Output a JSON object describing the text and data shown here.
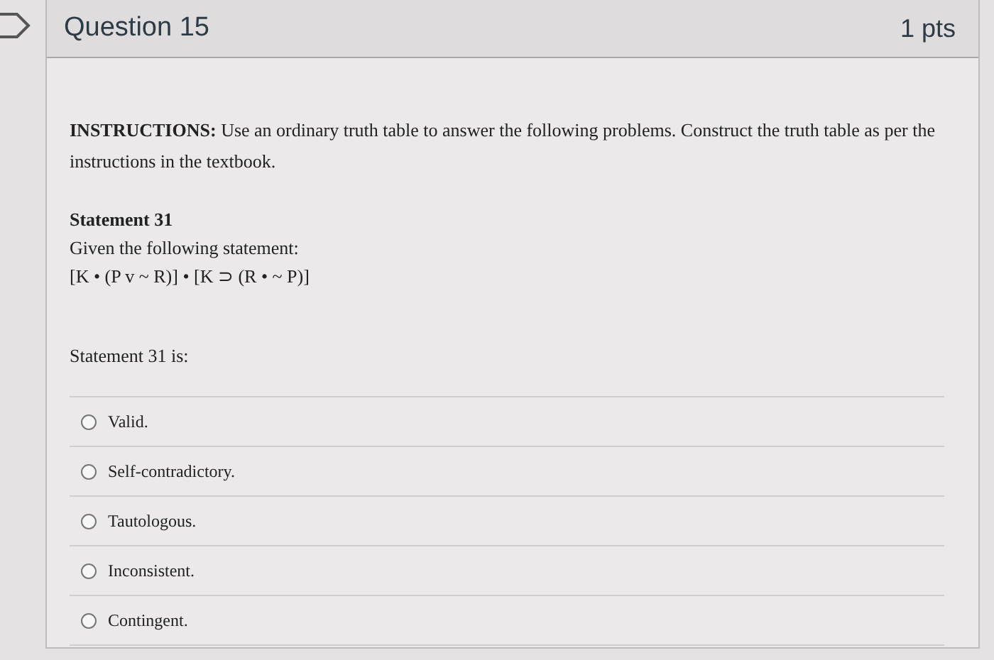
{
  "question": {
    "title": "Question 15",
    "points": "1 pts"
  },
  "instructions": {
    "label": "INSTRUCTIONS:",
    "text": "Use an ordinary truth table to answer the following problems. Construct the truth table as per the instructions in the textbook."
  },
  "statement": {
    "heading": "Statement 31",
    "intro": "Given the following statement:",
    "formula": "[K • (P v ~ R)] • [K ⊃ (R • ~ P)]"
  },
  "prompt": "Statement 31 is:",
  "options": [
    {
      "label": "Valid.",
      "selected": false
    },
    {
      "label": "Self-contradictory.",
      "selected": false
    },
    {
      "label": "Tautologous.",
      "selected": false
    },
    {
      "label": "Inconsistent.",
      "selected": false
    },
    {
      "label": "Contingent.",
      "selected": false
    }
  ]
}
